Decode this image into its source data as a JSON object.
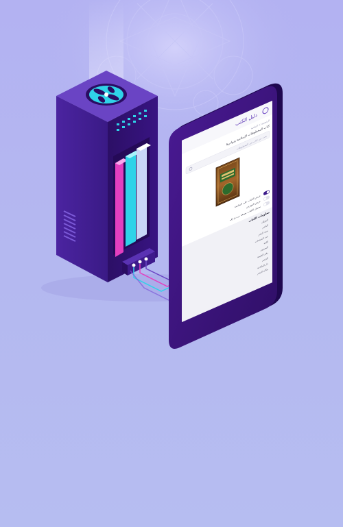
{
  "illustration": {
    "colors": {
      "background": "#b3b2f2",
      "server_dark": "#3a1880",
      "server_mid": "#4f2aa3",
      "server_light": "#6a44c4",
      "fan": "#2fd3e8",
      "book_pink": "#e33fc0",
      "book_cyan": "#2fd3e8",
      "book_light": "#c8d6f6",
      "tablet_frame": "#3c1478",
      "screen": "#ffffff",
      "toggle_on": "#3b1a8a"
    },
    "icons": {
      "server": "server-rack-icon",
      "fan": "fan-icon",
      "books": "book-spines-icon",
      "tablet": "tablet-device-icon",
      "cover": "book-cover-icon",
      "pattern": "arabesque-pattern-icon"
    }
  },
  "tablet_screen": {
    "header_text": "دليل الكتب",
    "breadcrumb": "الرئيسية > المكتبة",
    "title": "كتاب المخطوطات الإسلامية ونوادرها",
    "subtitle": "بحث عن كتاب في المخطوطات",
    "options": [
      "عرض الكتاب على الشاشة",
      "عرض الفهرس",
      "تحميل الكتاب بصيغة بي دي إف"
    ],
    "section_title": "معلومات الكتاب",
    "info_items": [
      "المؤلف",
      "الناشر",
      "سنة النشر",
      "عدد الصفحات",
      "اللغة",
      "التصنيف",
      "رقم الطبعة",
      "الحجم",
      "دار الطباعة",
      "مكان النشر"
    ]
  }
}
